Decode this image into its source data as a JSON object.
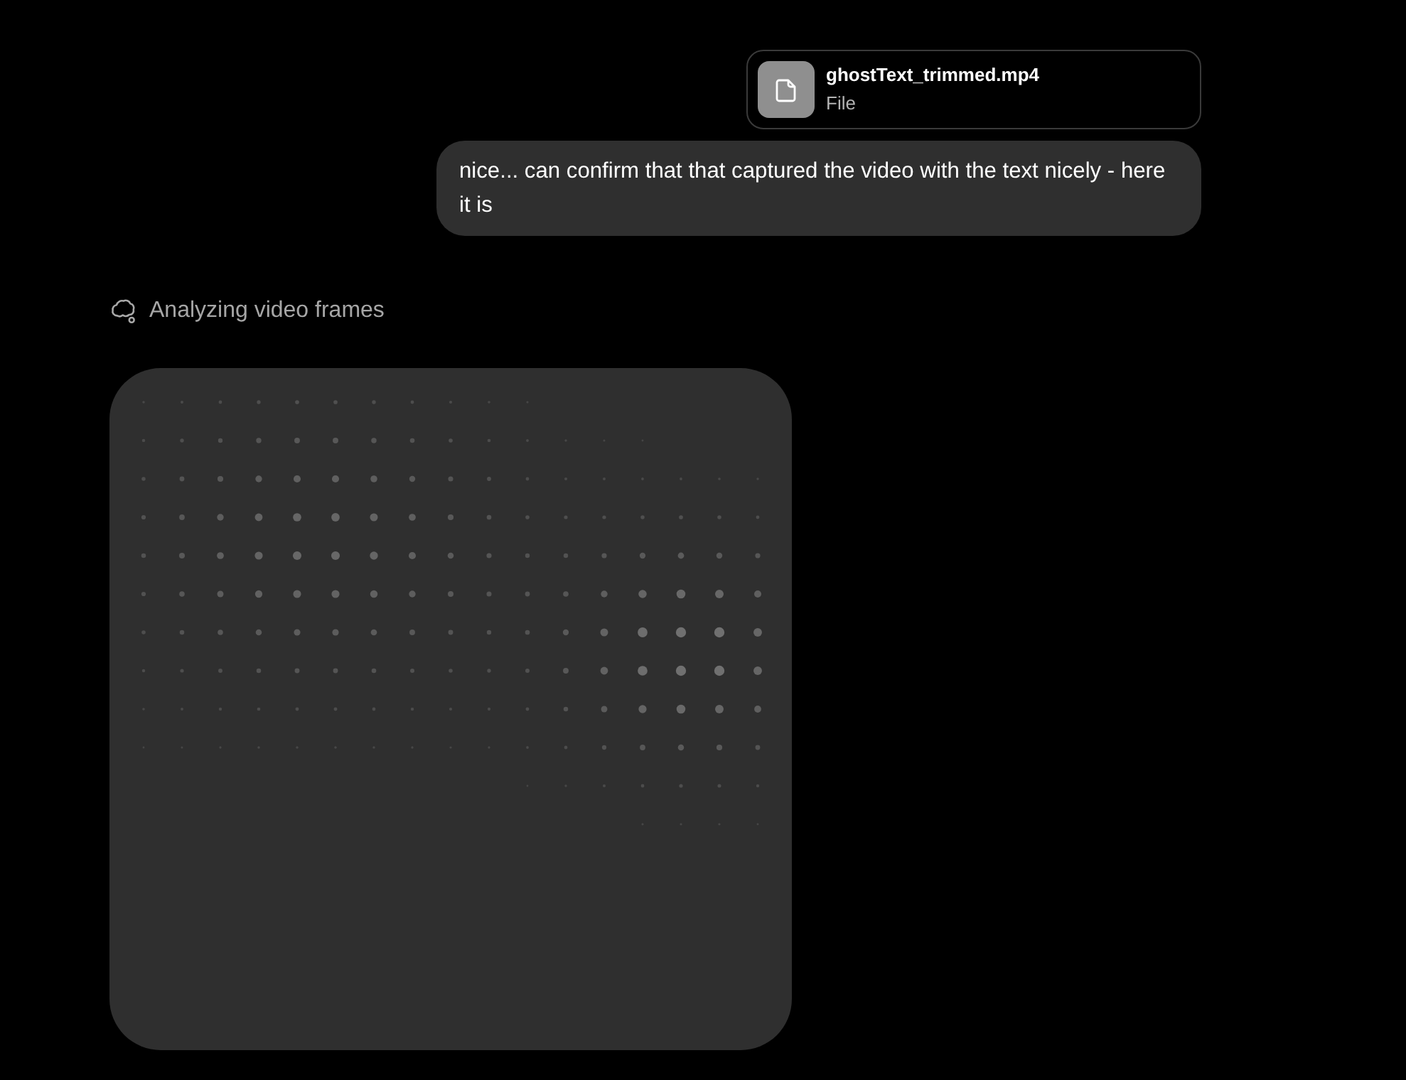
{
  "attachment": {
    "name": "ghostText_trimmed.mp4",
    "type": "File"
  },
  "message": {
    "text": "nice... can confirm that that captured the video with the text nicely - here it is"
  },
  "status": {
    "text": "Analyzing video frames"
  }
}
